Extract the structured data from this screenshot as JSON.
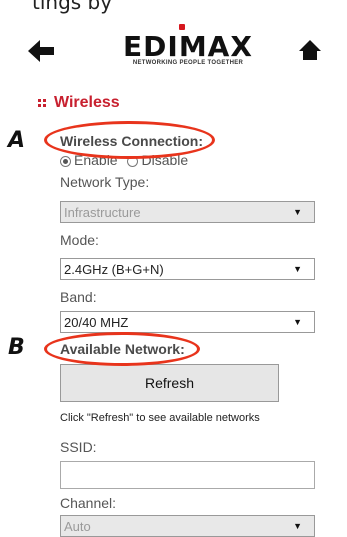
{
  "caption": "tings by",
  "header": {
    "logo_text": "EDIMAX",
    "logo_tagline": "NETWORKING PEOPLE TOGETHER"
  },
  "section": {
    "title": "Wireless"
  },
  "wireless_connection": {
    "label": "Wireless Connection:",
    "options": [
      "Enable",
      "Disable"
    ],
    "selected": "Enable"
  },
  "network_type": {
    "label": "Network Type:",
    "value": "Infrastructure"
  },
  "mode": {
    "label": "Mode:",
    "value": "2.4GHz (B+G+N)"
  },
  "band": {
    "label": "Band:",
    "value": "20/40 MHZ"
  },
  "available_network": {
    "label": "Available Network:",
    "refresh_label": "Refresh",
    "hint": "Click \"Refresh\" to see available networks"
  },
  "ssid": {
    "label": "SSID:",
    "value": ""
  },
  "channel": {
    "label": "Channel:",
    "value": "Auto"
  },
  "annotations": {
    "a": "A",
    "b": "B"
  },
  "colors": {
    "accent": "#c8202f",
    "annotation": "#e8341c",
    "logo_red": "#d6171e"
  }
}
